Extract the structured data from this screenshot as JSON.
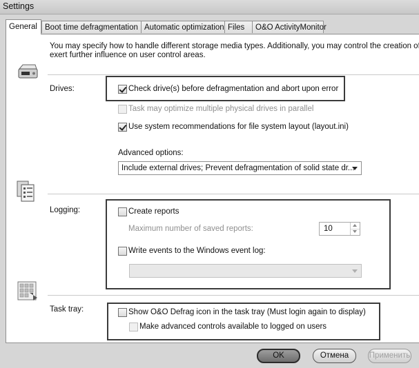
{
  "window": {
    "title": "Settings"
  },
  "tabs": [
    {
      "label": "General",
      "active": true
    },
    {
      "label": "Boot time defragmentation"
    },
    {
      "label": "Automatic optimization"
    },
    {
      "label": "Files"
    },
    {
      "label": "O&O ActivityMonitor"
    }
  ],
  "intro": {
    "line1": "You may specify how to handle different storage media types. Additionally, you may control the creation of repo",
    "line2": "exert further influence on user control areas."
  },
  "drives": {
    "label": "Drives:",
    "check_before_defrag": {
      "label": "Check drive(s) before defragmentation and abort upon error",
      "checked": true
    },
    "optimize_parallel": {
      "label": "Task may optimize multiple physical drives in parallel",
      "checked": false,
      "disabled": true
    },
    "system_recommendations": {
      "label": "Use system recommendations for file system layout (layout.ini)",
      "checked": true
    },
    "advanced_label": "Advanced options:",
    "advanced_value": "Include external drives; Prevent defragmentation of solid state dr..."
  },
  "logging": {
    "label": "Logging:",
    "create_reports": {
      "label": "Create reports",
      "checked": false
    },
    "max_reports_label": "Maximum number of saved reports:",
    "max_reports_value": "10",
    "write_events": {
      "label": "Write events to the Windows event log:",
      "checked": false
    },
    "event_log_value": ""
  },
  "task_tray": {
    "label": "Task tray:",
    "show_icon": {
      "label": "Show O&O Defrag icon in the task tray (Must login again to display)",
      "checked": false
    },
    "advanced_controls": {
      "label": "Make advanced controls available to logged on users",
      "checked": false,
      "disabled": true
    }
  },
  "buttons": {
    "ok": "OK",
    "cancel": "Отмена",
    "apply": "Применить"
  },
  "icons": {
    "drive": "drive-icon",
    "log": "log-icon",
    "tray": "tray-icon"
  },
  "colors": {
    "background": "#d6d6d6",
    "panel": "#ffffff",
    "highlight_border": "#3a3a3a"
  }
}
